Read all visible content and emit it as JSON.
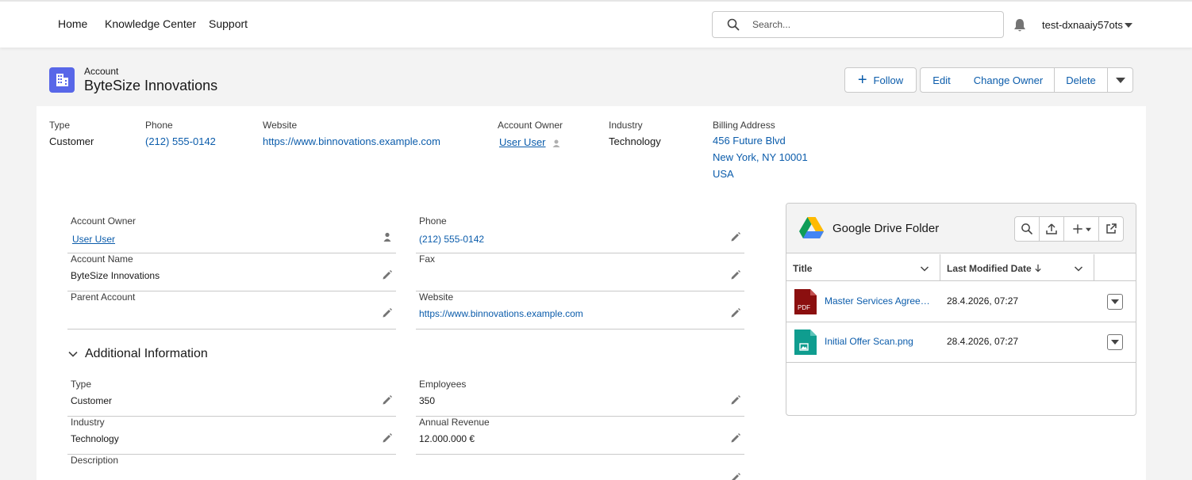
{
  "nav": {
    "items": [
      "Home",
      "Knowledge Center",
      "Support"
    ],
    "search_placeholder": "Search...",
    "user": "test-dxnaaiy57ots"
  },
  "header": {
    "object_label": "Account",
    "title": "ByteSize Innovations",
    "buttons": {
      "follow": "Follow",
      "edit": "Edit",
      "change_owner": "Change Owner",
      "delete": "Delete"
    }
  },
  "highlights": {
    "type": {
      "label": "Type",
      "value": "Customer"
    },
    "phone": {
      "label": "Phone",
      "value": "(212) 555-0142"
    },
    "website": {
      "label": "Website",
      "value": "https://www.binnovations.example.com"
    },
    "owner": {
      "label": "Account Owner",
      "value": "User User"
    },
    "industry": {
      "label": "Industry",
      "value": "Technology"
    },
    "billing": {
      "label": "Billing Address",
      "line1": "456 Future Blvd",
      "line2": "New York, NY 10001",
      "line3": "USA"
    }
  },
  "details": {
    "account_owner": {
      "label": "Account Owner",
      "value": "User User"
    },
    "phone": {
      "label": "Phone",
      "value": "(212) 555-0142"
    },
    "account_name": {
      "label": "Account Name",
      "value": "ByteSize Innovations"
    },
    "fax": {
      "label": "Fax",
      "value": ""
    },
    "parent_account": {
      "label": "Parent Account",
      "value": ""
    },
    "website": {
      "label": "Website",
      "value": "https://www.binnovations.example.com"
    }
  },
  "additional": {
    "title": "Additional Information",
    "type": {
      "label": "Type",
      "value": "Customer"
    },
    "employees": {
      "label": "Employees",
      "value": "350"
    },
    "industry": {
      "label": "Industry",
      "value": "Technology"
    },
    "annual_revenue": {
      "label": "Annual Revenue",
      "value": "12.000.000 €"
    },
    "description": {
      "label": "Description",
      "value": ""
    }
  },
  "drive": {
    "title": "Google Drive Folder",
    "columns": {
      "title": "Title",
      "modified": "Last Modified Date"
    },
    "files": [
      {
        "name": "Master Services Agreement.pdf",
        "date": "28.4.2026, 07:27",
        "icon": "pdf-file-icon",
        "color": "#8b0f0f"
      },
      {
        "name": "Initial Offer Scan.png",
        "date": "28.4.2026, 07:27",
        "icon": "image-file-icon",
        "color": "#0f9d8f"
      }
    ]
  },
  "colors": {
    "accent": "#0b5cab",
    "account_icon": "#5867e8"
  }
}
